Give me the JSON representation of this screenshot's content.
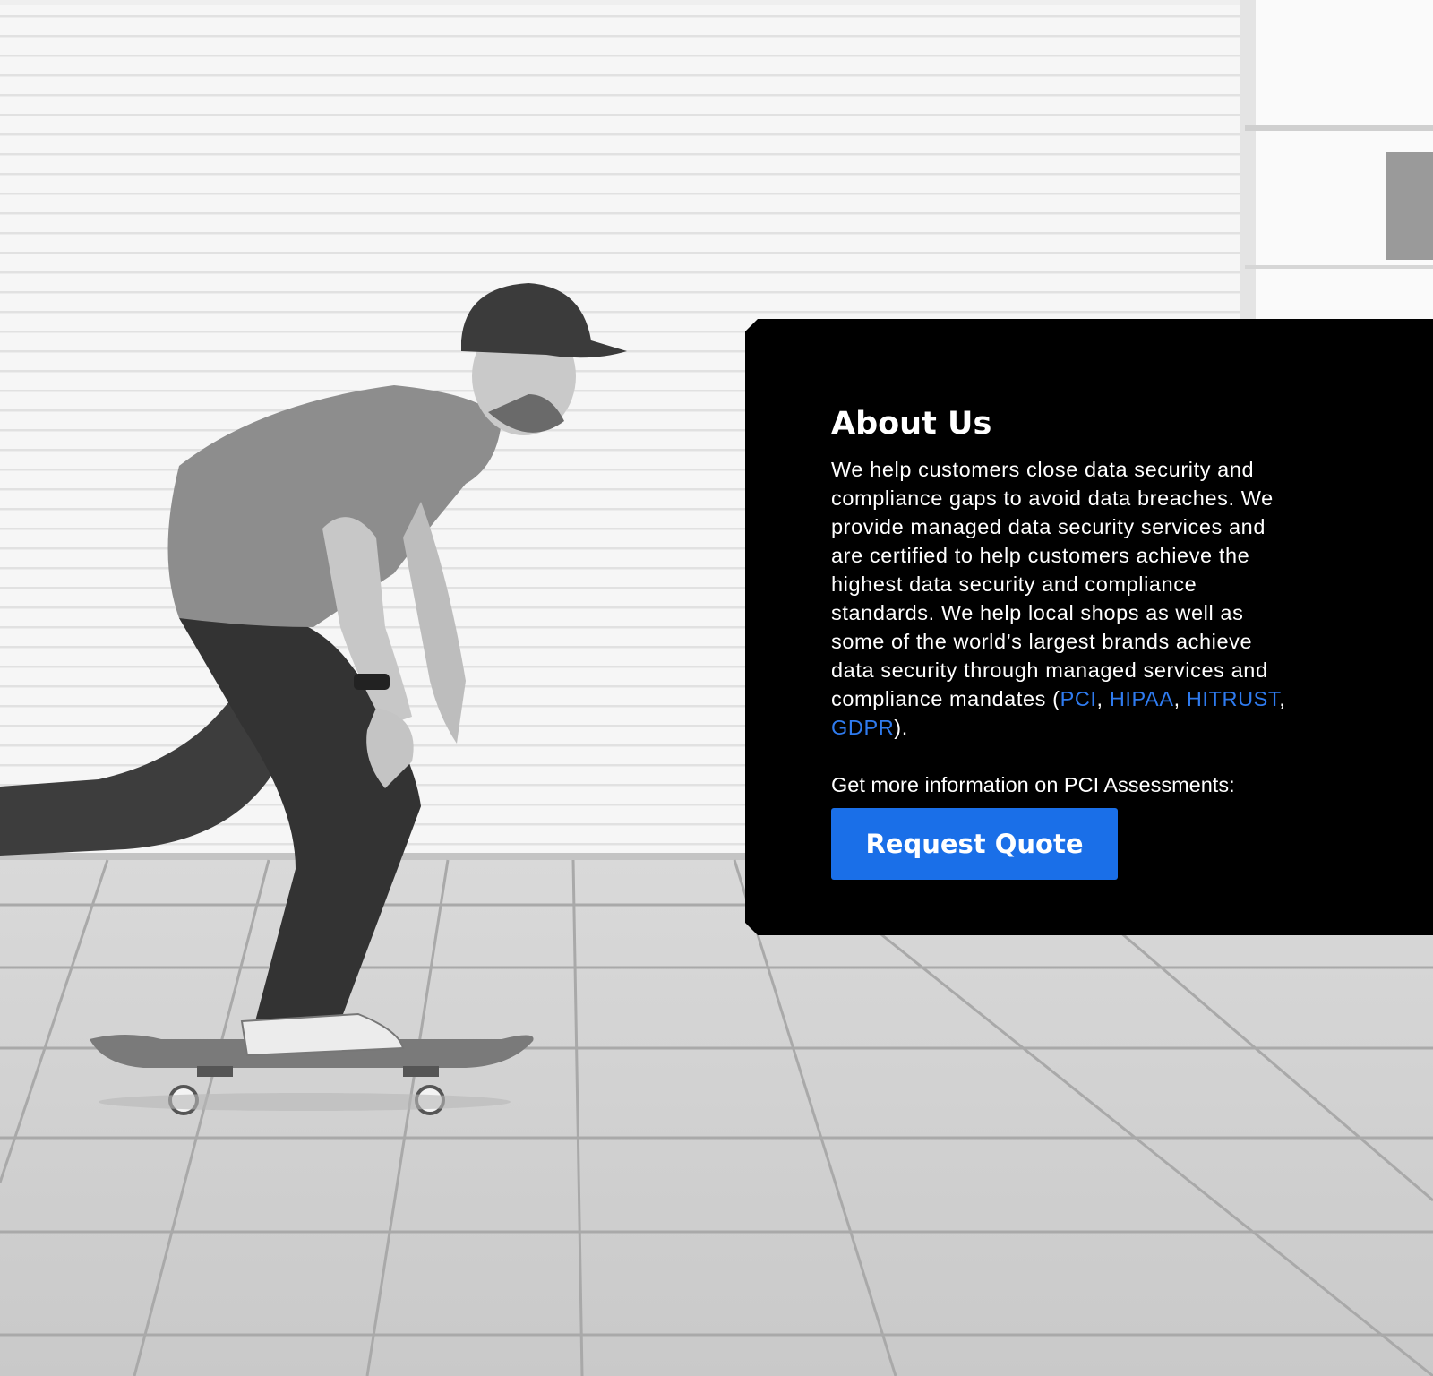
{
  "about": {
    "title": "About Us",
    "body_text": "We help customers close data security and compliance gaps to avoid data breaches. We provide managed data security services and are certified to help customers achieve the highest data security and compliance standards. We help local shops as well as some of the world’s largest brands achieve data security through managed services and compliance mandates (",
    "links": [
      "PCI",
      "HIPAA",
      "HITRUST",
      "GDPR"
    ],
    "separator": ", ",
    "closing": ").",
    "info_text": "Get more information on PCI Assessments:",
    "button_label": "Request Quote"
  },
  "colors": {
    "card_bg": "#000000",
    "link": "#2f7bef",
    "button_bg": "#1a6fe8"
  },
  "icons": {
    "hero": "skateboarder-photo"
  }
}
